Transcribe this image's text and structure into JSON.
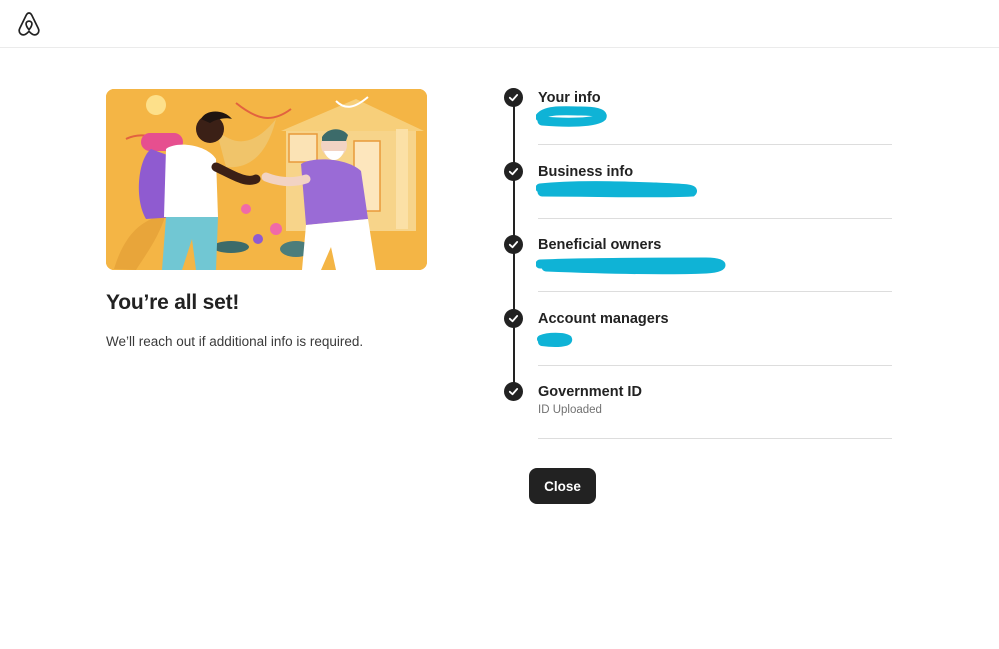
{
  "header": {
    "logo_icon": "airbnb-logo-icon"
  },
  "hero": {
    "illustration": "two-people-handshake-illustration"
  },
  "main": {
    "title": "You’re all set!",
    "subtitle": "We’ll reach out if additional info is required."
  },
  "steps": [
    {
      "label": "Your info",
      "detail": "",
      "status": "complete",
      "redacted": true
    },
    {
      "label": "Business info",
      "detail": "",
      "status": "complete",
      "redacted": true
    },
    {
      "label": "Beneficial owners",
      "detail": "",
      "status": "complete",
      "redacted": true
    },
    {
      "label": "Account managers",
      "detail": "",
      "status": "complete",
      "redacted": true
    },
    {
      "label": "Government ID",
      "detail": "ID Uploaded",
      "status": "complete",
      "redacted": false
    }
  ],
  "actions": {
    "close_label": "Close"
  },
  "colors": {
    "primary_text": "#222222",
    "secondary_text": "#717171",
    "redaction": "#0fb3d6",
    "hero_bg": "#f4b545",
    "button_bg": "#222222"
  }
}
